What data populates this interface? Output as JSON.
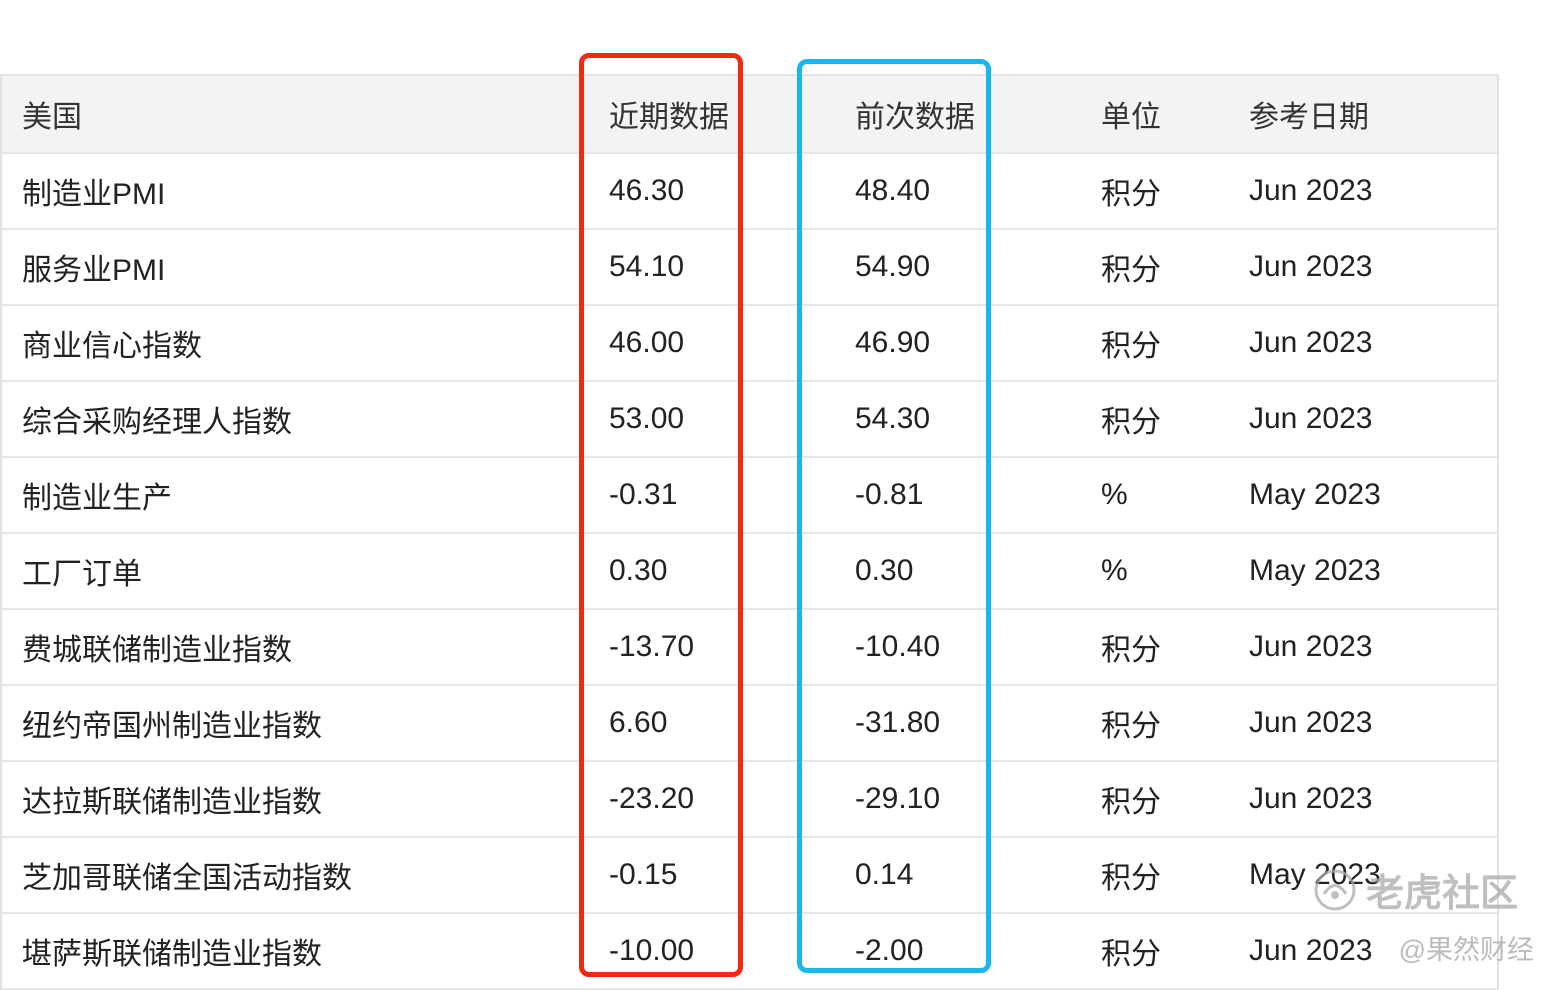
{
  "table": {
    "headers": [
      "美国",
      "近期数据",
      "前次数据",
      "单位",
      "参考日期"
    ],
    "rows": [
      [
        "制造业PMI",
        "46.30",
        "48.40",
        "积分",
        "Jun 2023"
      ],
      [
        "服务业PMI",
        "54.10",
        "54.90",
        "积分",
        "Jun 2023"
      ],
      [
        "商业信心指数",
        "46.00",
        "46.90",
        "积分",
        "Jun 2023"
      ],
      [
        "综合采购经理人指数",
        "53.00",
        "54.30",
        "积分",
        "Jun 2023"
      ],
      [
        "制造业生产",
        "-0.31",
        "-0.81",
        "%",
        "May 2023"
      ],
      [
        "工厂订单",
        "0.30",
        "0.30",
        "%",
        "May 2023"
      ],
      [
        "费城联储制造业指数",
        "-13.70",
        "-10.40",
        "积分",
        "Jun 2023"
      ],
      [
        "纽约帝国州制造业指数",
        "6.60",
        "-31.80",
        "积分",
        "Jun 2023"
      ],
      [
        "达拉斯联储制造业指数",
        "-23.20",
        "-29.10",
        "积分",
        "Jun 2023"
      ],
      [
        "芝加哥联储全国活动指数",
        "-0.15",
        "0.14",
        "积分",
        "May 2023"
      ],
      [
        "堪萨斯联储制造业指数",
        "-10.00",
        "-2.00",
        "积分",
        "Jun 2023"
      ]
    ]
  },
  "highlights": {
    "latest_color": "#ee2a14",
    "previous_color": "#1ab6f0"
  },
  "watermark": {
    "logo_icon": "tiger-community-logo-icon",
    "logo_text": "老虎社区",
    "author": "@果然财经"
  }
}
